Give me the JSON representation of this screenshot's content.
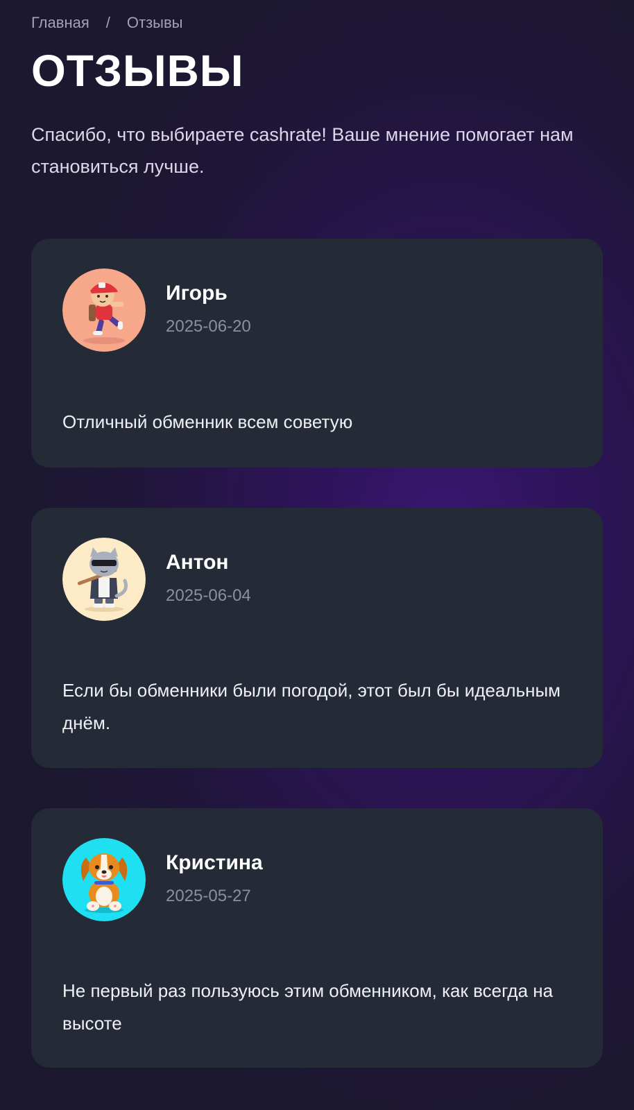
{
  "breadcrumb": {
    "home": "Главная",
    "separator": "/",
    "current": "Отзывы"
  },
  "page": {
    "title": "ОТЗЫВЫ",
    "intro": "Спасибо, что выбираете cashrate! Ваше мнение помогает нам становиться лучше."
  },
  "reviews": [
    {
      "author": "Игорь",
      "date": "2025-06-20",
      "text": "Отличный обменник всем советую",
      "avatar_bg": "#f7a88b",
      "avatar_icon": "boy-cap-skateboard-icon"
    },
    {
      "author": "Антон",
      "date": "2025-06-04",
      "text": "Если бы обменники были погодой, этот был бы идеальным днём.",
      "avatar_bg": "#fdebc8",
      "avatar_icon": "cool-cat-sunglasses-icon"
    },
    {
      "author": "Кристина",
      "date": "2025-05-27",
      "text": "Не первый раз пользуюсь этим обменником, как всегда на высоте",
      "avatar_bg": "#1ee0f2",
      "avatar_icon": "puppy-dog-icon"
    }
  ],
  "colors": {
    "background": "#2c1457",
    "card": "#252a37",
    "muted_text": "#8c8f9c"
  }
}
